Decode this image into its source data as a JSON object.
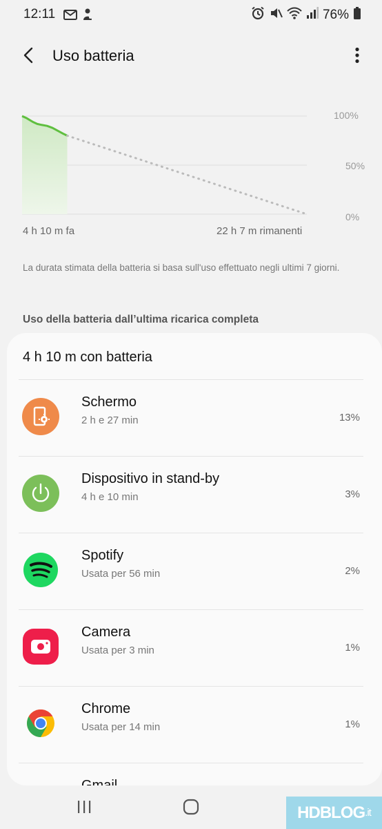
{
  "status_bar": {
    "time": "12:11",
    "battery_percent": "76%",
    "left_icons": [
      "gmail-icon",
      "notification-icon"
    ],
    "right_icons": [
      "alarm-icon",
      "mute-icon",
      "wifi-icon",
      "signal-icon",
      "battery-icon"
    ]
  },
  "header": {
    "title": "Uso batteria",
    "back_icon": "arrow-back-icon",
    "menu_icon": "more-vertical-icon"
  },
  "chart": {
    "ytick_100": "100%",
    "ytick_50": "50%",
    "ytick_0": "0%",
    "x_left": "4 h 10 m fa",
    "x_right": "22 h 7 m rimanenti",
    "line_color": "#5fbf3f",
    "projection_color": "#bbbbbb"
  },
  "chart_data": {
    "type": "line",
    "x": [
      0,
      0.4,
      0.7,
      1.0,
      1.4,
      1.8,
      2.3,
      2.8,
      3.3,
      3.8,
      4.17,
      26.28
    ],
    "series": [
      {
        "values": [
          100,
          98,
          96,
          94,
          92,
          91,
          90,
          88,
          85,
          82,
          80,
          null
        ]
      },
      {
        "values": [
          null,
          null,
          null,
          null,
          null,
          null,
          null,
          null,
          null,
          null,
          80,
          0
        ]
      }
    ],
    "ylim": [
      0,
      100
    ]
  },
  "note": "La durata stimata della batteria si basa sull'uso effettuato negli ultimi 7 giorni.",
  "section_heading": "Uso della batteria dall’ultima ricarica completa",
  "usage": {
    "summary": "4 h 10 m con batteria",
    "items": [
      {
        "name": "Schermo",
        "detail": "2 h e 27 min",
        "percent": "13%",
        "icon": "screen-brightness-icon",
        "color": "#ef8a4a"
      },
      {
        "name": "Dispositivo in stand-by",
        "detail": "4 h e 10 min",
        "percent": "3%",
        "icon": "power-icon",
        "color": "#7cbf5a"
      },
      {
        "name": "Spotify",
        "detail": "Usata per 56 min",
        "percent": "2%",
        "icon": "spotify-icon",
        "color": "#1ed760"
      },
      {
        "name": "Camera",
        "detail": "Usata per 3 min",
        "percent": "1%",
        "icon": "camera-icon",
        "color": "#ee1e4a"
      },
      {
        "name": "Chrome",
        "detail": "Usata per 14 min",
        "percent": "1%",
        "icon": "chrome-icon",
        "color": "#4285f4"
      },
      {
        "name": "Gmail",
        "detail": "",
        "percent": "",
        "icon": "gmail-app-icon",
        "color": "#ea4335"
      }
    ]
  },
  "navbar": {
    "recents_icon": "recents-icon",
    "home_icon": "home-icon",
    "back_icon": "nav-back-icon"
  },
  "watermark": {
    "main": "HDBLOG",
    "suffix": ".it"
  }
}
